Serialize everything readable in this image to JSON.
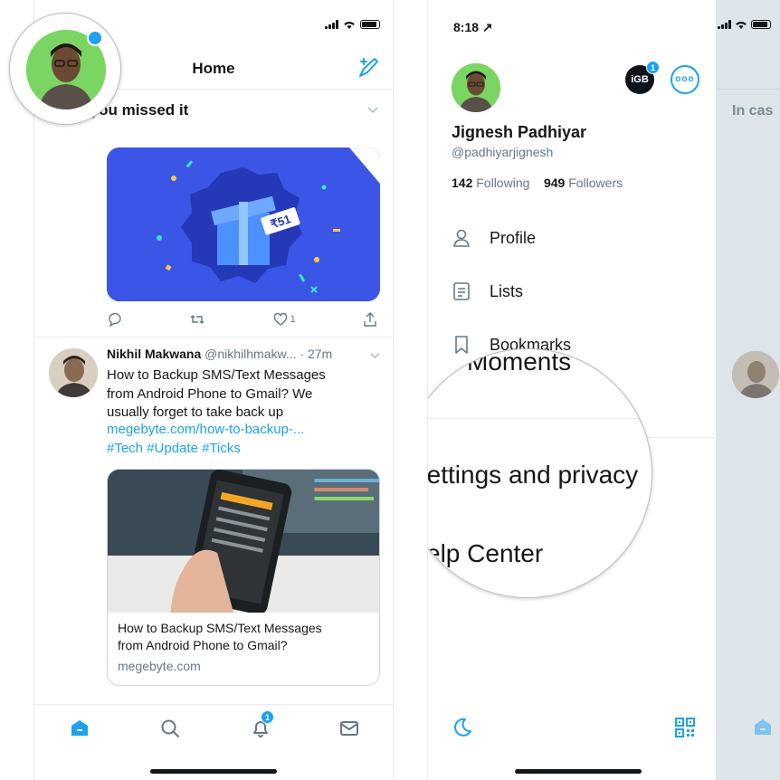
{
  "left_phone": {
    "header": {
      "title": "Home",
      "notification_dot": true
    },
    "section": {
      "title": "ce you missed it"
    },
    "promo": {
      "price_tag": "₹51"
    },
    "promo_actions": {
      "like_count": "1"
    },
    "tweet": {
      "author": "Nikhil Makwana",
      "handle": "@nikhilhmakw...",
      "time": "· 27m",
      "lines": [
        "How to Backup SMS/Text Messages",
        "from Android Phone to Gmail? We",
        "usually forget to take back up"
      ],
      "link": "megebyte.com/how-to-backup-...",
      "hashtags": "#Tech #Update #Ticks",
      "card": {
        "title_lines": [
          "How to Backup SMS/Text Messages",
          "from Android Phone to Gmail?"
        ],
        "domain": "megebyte.com"
      }
    },
    "tabbar": {
      "notifications_badge": "1"
    }
  },
  "right_phone": {
    "status": {
      "time": "8:18 ↗"
    },
    "account": {
      "name": "Jignesh Padhiyar",
      "handle": "@padhiyarjignesh",
      "following_count": "142",
      "following_label": "Following",
      "followers_count": "949",
      "followers_label": "Followers",
      "switcher_label": "iGB",
      "switcher_badge": "1",
      "more_label": "ooo"
    },
    "menu": [
      {
        "label": "Profile",
        "icon": "person-icon"
      },
      {
        "label": "Lists",
        "icon": "lists-icon"
      },
      {
        "label": "Bookmarks",
        "icon": "bookmark-icon"
      }
    ],
    "zoom": {
      "moments": "Moments",
      "settings": "Settings and privacy",
      "help": "elp Center"
    },
    "peek": {
      "text": "In cas"
    }
  },
  "colors": {
    "accent": "#1da1f2",
    "promo_bg": "#3b55e6",
    "text": "#14171a",
    "secondary": "#657786"
  }
}
